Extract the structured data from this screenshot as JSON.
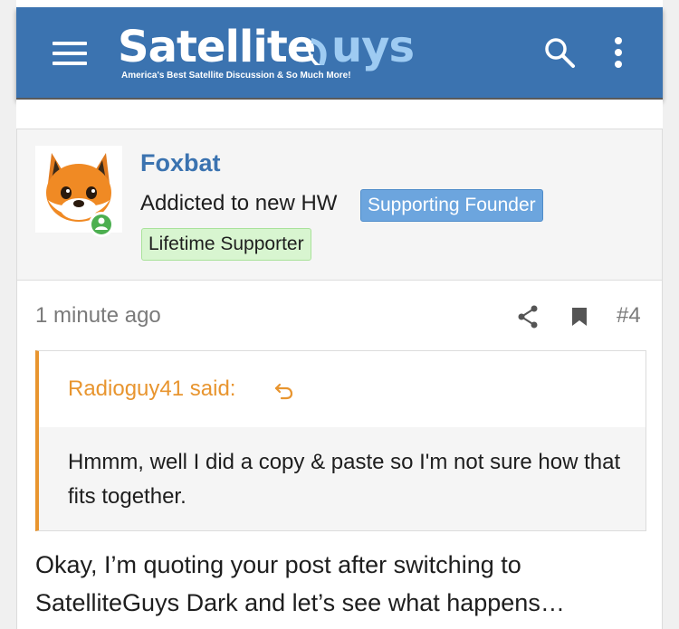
{
  "header": {
    "menu_icon": "hamburger-menu-icon",
    "logo_word_primary": "Satellite",
    "logo_word_secondary": "uys",
    "logo_tagline": "America's Best Satellite Discussion & So Much More!",
    "search_icon": "search-icon",
    "more_icon": "more-vertical-icon",
    "color": "#3b73b0"
  },
  "post": {
    "author": {
      "username": "Foxbat",
      "user_title": "Addicted to new HW",
      "banners": [
        "Supporting Founder",
        "Lifetime Supporter"
      ],
      "avatar_icon": "fox-avatar-icon",
      "online_status_icon": "online-status-icon"
    },
    "timestamp": "1 minute ago",
    "actions": {
      "share_icon": "share-icon",
      "bookmark_icon": "bookmark-icon",
      "post_number": "#4"
    },
    "quote": {
      "author_label": "Radioguy41 said:",
      "jump_icon": "jump-to-quote-icon",
      "text": "Hmmm, well I did a copy & paste so I'm not sure how that fits together.",
      "accent_color": "#e8952f"
    },
    "message": "Okay, I’m quoting your post after switching to SatelliteGuys Dark and let’s see what happens…"
  },
  "colors": {
    "link_blue": "#3b73b0",
    "founder_badge": "#6ca5de",
    "lifetime_badge": "#d8f5d0",
    "online_green": "#4caf50"
  }
}
